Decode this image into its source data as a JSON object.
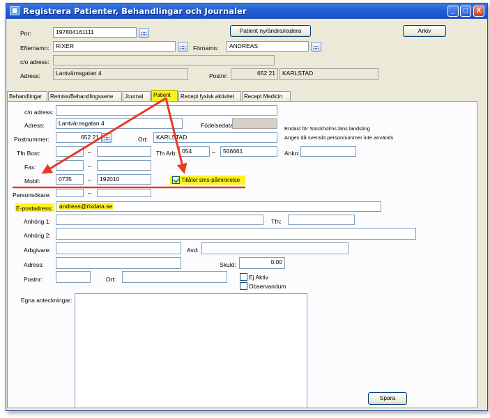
{
  "window": {
    "title": "Registrera Patienter, Behandlingar och Journaler",
    "controls": {
      "minimize": "_",
      "maximize": "□",
      "close": "X"
    }
  },
  "header": {
    "pnr_label": "Pnr:",
    "pnr_value": "197804161111",
    "efternamn_label": "Efternamn:",
    "efternamn_value": "RIXER",
    "fornamn_label": "Förnamn:",
    "fornamn_value": "ANDREAS",
    "co_label": "c/o adress:",
    "co_value": "",
    "adress_label": "Adress:",
    "adress_value": "Lantvärnsgatan 4",
    "postnr_label": "Postnr:",
    "postnr_value": "652 21",
    "ort_value": "KARLSTAD",
    "patient_button": "Patient ny/ändra/radera",
    "arkiv_button": "Arkiv"
  },
  "tabs": [
    {
      "label": "Behandlingar",
      "active": false
    },
    {
      "label": "Remiss/Behandlingsserie",
      "active": false
    },
    {
      "label": "Journal",
      "active": false
    },
    {
      "label": "Patient",
      "active": true
    },
    {
      "label": "Recept fysisk aktivitet",
      "active": false
    },
    {
      "label": "Recept Medicin",
      "active": false
    }
  ],
  "patient": {
    "co_label": "c/o adress:",
    "co_value": "",
    "adress_label": "Adress:",
    "adress_value": "Lantvärnsgatan 4",
    "fodelsedata_label": "Födelsedata:",
    "fodelsedata_value": "",
    "info_stockholm": "Endast för Stockholms läns landsting",
    "info_personnummer": "Anges då svenskt personnummer inte används",
    "postnummer_label": "Postnummer:",
    "postnummer_value": "652 21",
    "ort_label": "Ort:",
    "ort_value": "KARLSTAD",
    "tfn_bost_label": "Tfn Bost:",
    "tfn_bost_area": "",
    "tfn_bost_number": "",
    "tfn_arb_label": "Tfn Arb:",
    "tfn_arb_area": "054",
    "tfn_arb_number": "566661",
    "ankn_label": "Ankn:",
    "ankn_value": "",
    "fax_label": "Fax:",
    "fax_area": "",
    "fax_number": "",
    "mobil_label": "Mobil:",
    "mobil_area": "0735",
    "mobil_number": "192010",
    "sms_label": "Tillåter sms-påminnelse",
    "sms_checked": true,
    "personsokare_label": "Personsökare:",
    "personsokare_area": "",
    "personsokare_number": "",
    "epost_label": "E-postadress:",
    "epost_value": "andreas@rixdata.se",
    "anhorig1_label": "Anhörig 1:",
    "anhorig1_value": "",
    "anhorig1_tfn_label": "Tfn:",
    "anhorig1_tfn_value": "",
    "anhorig2_label": "Anhörig 2:",
    "anhorig2_value": "",
    "arbgivare_label": "Arbgivare:",
    "arbgivare_value": "",
    "avd_label": "Avd:",
    "avd_value": "",
    "arb_adress_label": "Adress:",
    "arb_adress_value": "",
    "skuld_label": "Skuld:",
    "skuld_value": "0,00",
    "arb_postnr_label": "Postnr:",
    "arb_postnr_value": "",
    "arb_ort_label": "Ort:",
    "arb_ort_value": "",
    "ej_aktiv_label": "Ej Aktiv",
    "observandum_label": "Observandum",
    "anteckningar_label": "Egna anteckningar:",
    "anteckningar_value": "",
    "spara_button": "Spara",
    "dash": "–"
  },
  "colors": {
    "highlight": "#fff11f",
    "annotation": "#e53a25",
    "titlebar": "#2460d8"
  }
}
